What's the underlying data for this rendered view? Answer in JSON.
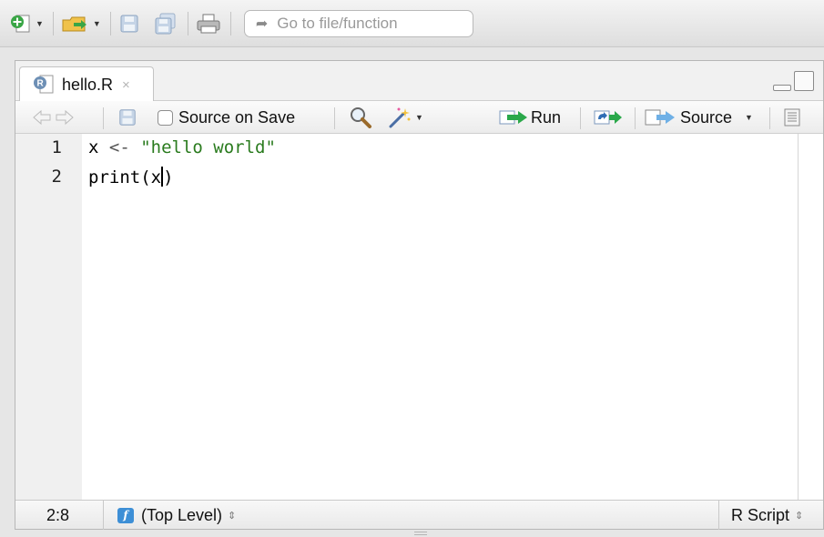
{
  "main_toolbar": {
    "new_file_icon": "new-file-plus-icon",
    "open_icon": "open-folder-icon",
    "save_icon": "save-icon",
    "save_all_icon": "save-all-icon",
    "print_icon": "print-icon",
    "goto_placeholder": "Go to file/function"
  },
  "tab": {
    "label": "hello.R",
    "close": "×"
  },
  "editor_toolbar": {
    "source_on_save": "Source on Save",
    "run": "Run",
    "source": "Source"
  },
  "code": {
    "lines": [
      {
        "number": "1",
        "tokens": [
          "x",
          " <- ",
          "\"hello world\""
        ]
      },
      {
        "number": "2",
        "before_cursor": "print(x",
        "after_cursor": ")"
      }
    ]
  },
  "status_bar": {
    "position": "2:8",
    "scope": "(Top Level)",
    "scope_arrows": "⇕",
    "file_type": "R Script",
    "file_type_arrows": "⇕",
    "fn_badge": "f"
  },
  "colors": {
    "string": "#2a7b1e",
    "run_arrow": "#2aa84a",
    "function_badge": "#3d8fd6"
  }
}
